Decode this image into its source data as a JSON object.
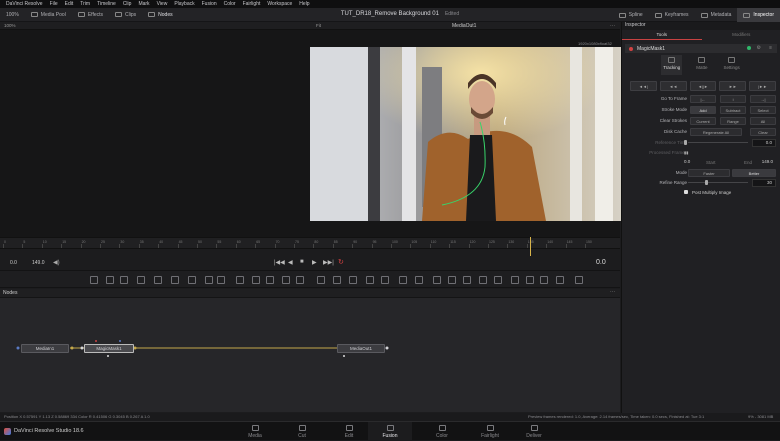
{
  "menubar": {
    "items": [
      "DaVinci Resolve",
      "File",
      "Edit",
      "Trim",
      "Timeline",
      "Clip",
      "Mark",
      "View",
      "Playback",
      "Fusion",
      "Color",
      "Fairlight",
      "Workspace",
      "Help"
    ]
  },
  "toolbar": {
    "left_items": [
      "Media Pool",
      "Effects",
      "Clips",
      "Nodes"
    ],
    "project_title": "TUT_DR18_Remove Background 01",
    "edit_status": "Edited",
    "right_items": [
      "Spline",
      "Keyframes",
      "Metadata",
      "Inspector"
    ]
  },
  "viewer": {
    "zoom_left": "100%",
    "fit": "Fit",
    "output_name": "MediaOut1",
    "resolution": "1920x1080xfloat32"
  },
  "ruler": {
    "ticks": [
      "0",
      "5",
      "10",
      "15",
      "20",
      "25",
      "30",
      "35",
      "40",
      "45",
      "50",
      "55",
      "60",
      "65",
      "70",
      "75",
      "80",
      "85",
      "90",
      "95",
      "100",
      "105",
      "110",
      "115",
      "120",
      "125",
      "130",
      "135",
      "140",
      "145",
      "150"
    ]
  },
  "transport": {
    "start": "0.0",
    "end": "149.0",
    "current": "0.0"
  },
  "nodes": {
    "header": "Nodes",
    "list": [
      {
        "id": "media-in",
        "label": "MediaIn1"
      },
      {
        "id": "magic-mask",
        "label": "MagicMask1"
      },
      {
        "id": "media-out",
        "label": "MediaOut1"
      }
    ]
  },
  "status": {
    "left": "Position X 0.57591   Y 1.13   Z 0.58869   334        Color R 0.41506   G 0.3045   B 0.267   A 1.0",
    "right": "Preview frames rendered: 1.0,  Average: 2.14 frames/sec,  Time taken: 0.0 secs,  Finished at: Tue 3:1",
    "mem": "9% - 3081 MB"
  },
  "pages": {
    "app_name": "DaVinci Resolve Studio 18.6",
    "tabs": [
      "Media",
      "Cut",
      "Edit",
      "Fusion",
      "Color",
      "Fairlight",
      "Deliver"
    ],
    "active": "Fusion"
  },
  "inspector": {
    "title": "Inspector",
    "tabs": [
      "Tools",
      "Modifiers"
    ],
    "node_name": "MagicMask1",
    "sub_tabs": [
      "Tracking",
      "Matte",
      "Settings"
    ],
    "track_buttons": [
      "◄◄|",
      "◄◄",
      "◄||►",
      "►►",
      "|►►"
    ],
    "go_to_frame_label": "Go To Frame",
    "stroke_mode_label": "Stroke Mode",
    "stroke_mode_opts": [
      "Add",
      "Subtract",
      "Select"
    ],
    "clear_strokes_label": "Clear Strokes",
    "clear_strokes_opts": [
      "Current",
      "Range",
      "All"
    ],
    "disk_cache_label": "Disk Cache",
    "disk_cache_opts": [
      "Regenerate All",
      "Clear"
    ],
    "ref_time_label": "Reference Time",
    "ref_time_val": "0.0",
    "processed_frames_label": "Processed Frames",
    "start_val": "0.0",
    "start_label": "Start",
    "end_label": "End",
    "end_val": "149.0",
    "mode_label": "Mode",
    "mode_opts": [
      "Faster",
      "Better"
    ],
    "refine_label": "Refine Range",
    "refine_val": "30",
    "refine_fraction": 0.3,
    "post_multiply_label": "Post Multiply Image"
  }
}
